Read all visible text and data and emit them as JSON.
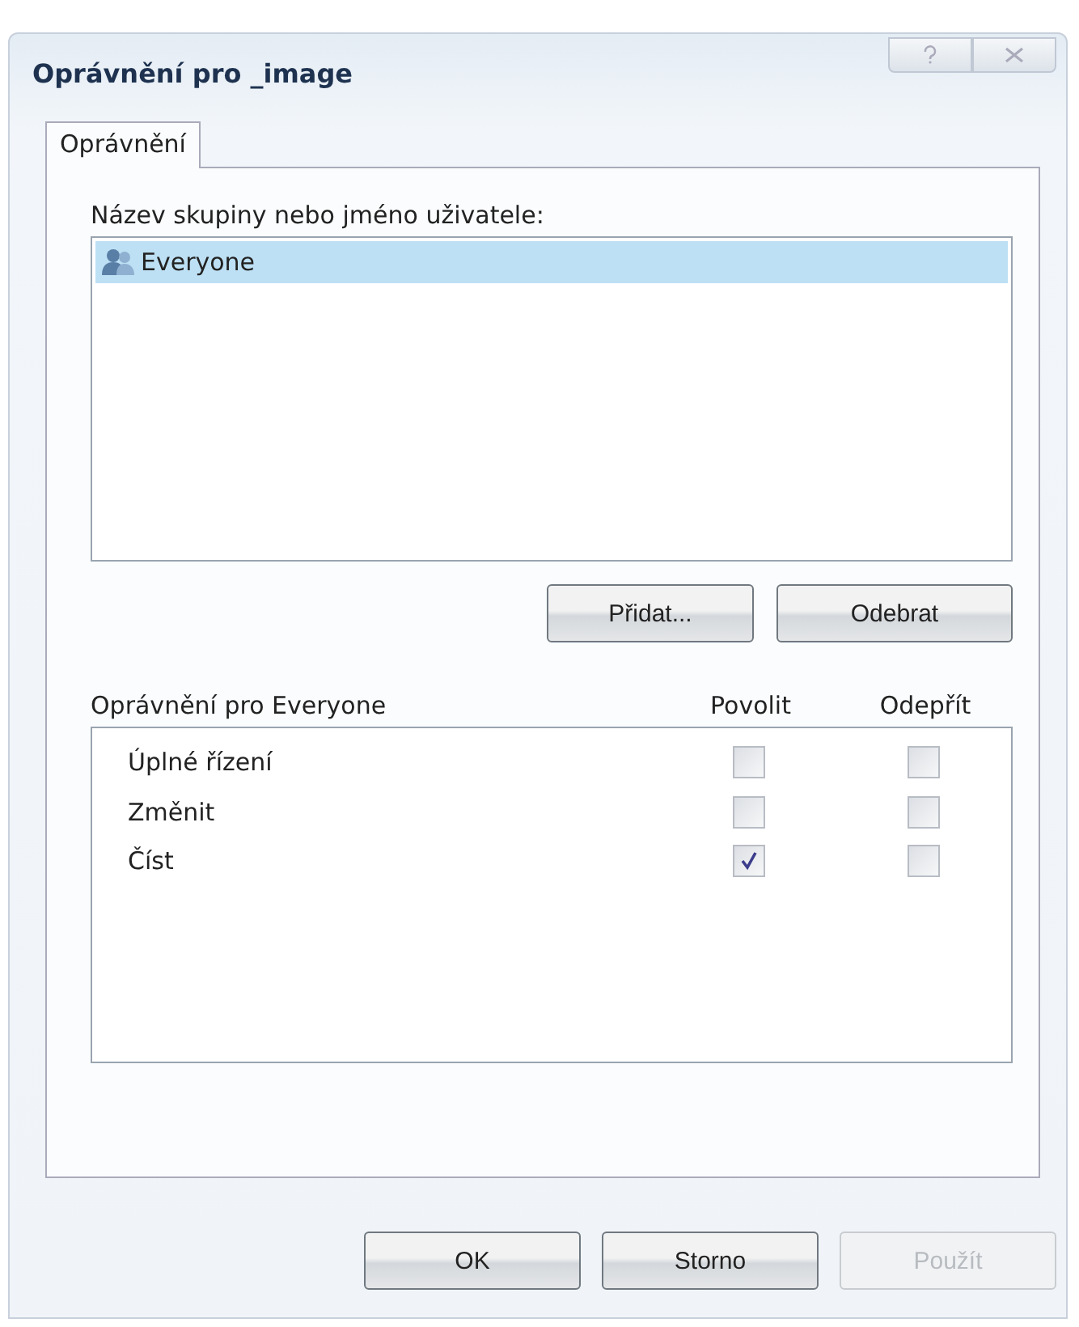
{
  "window": {
    "title": "Oprávnění pro _image"
  },
  "tabs": [
    {
      "label": "Oprávnění",
      "selected": true
    }
  ],
  "users": {
    "label": "Název skupiny nebo jméno uživatele:",
    "items": [
      {
        "name": "Everyone",
        "selected": true
      }
    ],
    "buttons": [
      {
        "label": "Přidat...",
        "disabled": false
      },
      {
        "label": "Odebrat",
        "disabled": false
      }
    ]
  },
  "permissions": {
    "label": "Oprávnění pro Everyone",
    "columns": [
      "Povolit",
      "Odepřít"
    ],
    "rows": [
      {
        "name": "Úplné řízení",
        "allow": false,
        "deny": false
      },
      {
        "name": "Změnit",
        "allow": false,
        "deny": false
      },
      {
        "name": "Číst",
        "allow": true,
        "deny": false
      }
    ]
  },
  "buttons": [
    {
      "label": "OK",
      "disabled": false
    },
    {
      "label": "Storno",
      "disabled": false
    },
    {
      "label": "Použít",
      "disabled": true
    }
  ]
}
